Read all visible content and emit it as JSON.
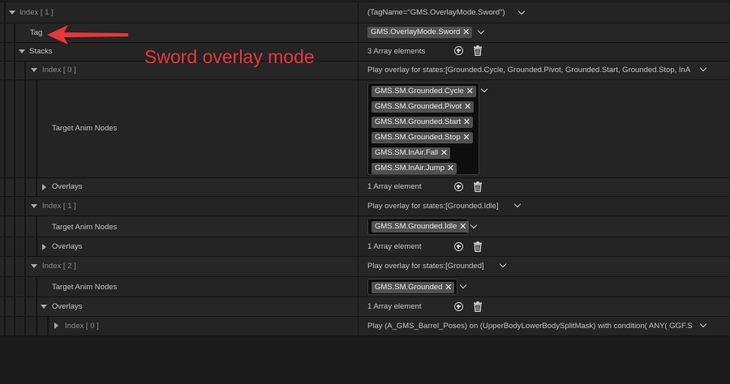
{
  "annotation": {
    "text": "Sword overlay mode",
    "color": "#e8363a"
  },
  "rows": {
    "index1": {
      "label": "Index [ 1 ]",
      "value": "(TagName=\"GMS.OverlayMode.Sword\")"
    },
    "tag": {
      "label": "Tag",
      "value": "GMS.OverlayMode.Sword"
    },
    "stacks": {
      "label": "Stacks",
      "value": "3 Array elements"
    },
    "stack0": {
      "label": "Index [ 0 ]",
      "value": "Play overlay for states:[Grounded.Cycle, Grounded.Pivot, Grounded.Start, Grounded.Stop, InA"
    },
    "stack0_nodes": {
      "label": "Target Anim Nodes",
      "tags": [
        "GMS.SM.Grounded.Cycle",
        "GMS.SM.Grounded.Pivot",
        "GMS.SM.Grounded.Start",
        "GMS.SM.Grounded.Stop",
        "GMS.SM.InAir.Fall",
        "GMS.SM.InAir.Jump"
      ]
    },
    "stack0_overlays": {
      "label": "Overlays",
      "value": "1 Array element"
    },
    "stack1": {
      "label": "Index [ 1 ]",
      "value": "Play overlay for states:[Grounded.Idle]"
    },
    "stack1_nodes": {
      "label": "Target Anim Nodes",
      "tags": [
        "GMS.SM.Grounded.Idle"
      ]
    },
    "stack1_overlays": {
      "label": "Overlays",
      "value": "1 Array element"
    },
    "stack2": {
      "label": "Index [ 2 ]",
      "value": "Play overlay for states:[Grounded]"
    },
    "stack2_nodes": {
      "label": "Target Anim Nodes",
      "tags": [
        "GMS.SM.Grounded"
      ]
    },
    "stack2_overlays": {
      "label": "Overlays",
      "value": "1 Array element"
    },
    "stack2_overlay0": {
      "label": "Index [ 0 ]",
      "value": "Play (A_GMS_Barrel_Poses) on (UpperBodyLowerBodySplitMask) with condition( ANY( GGF.S"
    }
  },
  "icons": {
    "remove": "close-icon",
    "add": "add-element-icon",
    "delete": "trash-icon",
    "dropdown": "chevron-down-icon"
  }
}
